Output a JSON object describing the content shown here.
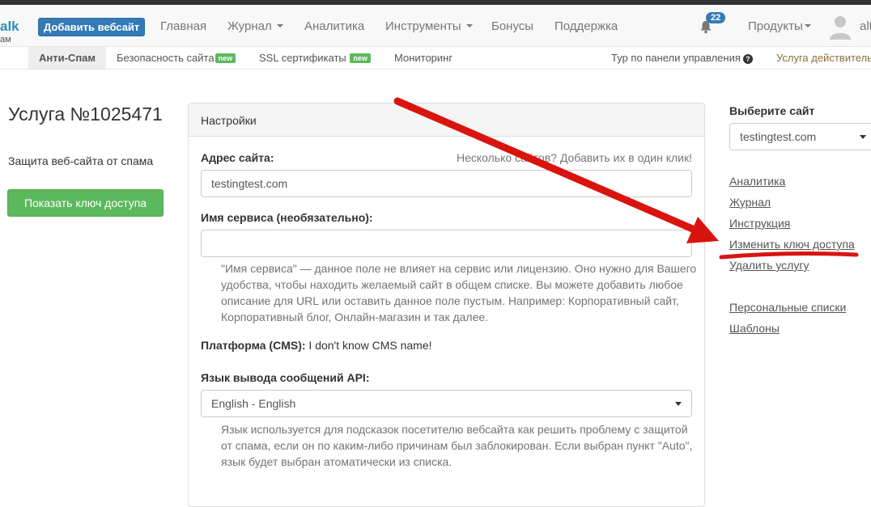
{
  "header": {
    "brand": "alk",
    "brand_sub": "ам",
    "add_site_button": "Добавить вебсайт",
    "nav": [
      "Главная",
      "Журнал",
      "Аналитика",
      "Инструменты",
      "Бонусы",
      "Поддержка"
    ],
    "notifications_count": "22",
    "products": "Продукты",
    "username": "alt"
  },
  "subnav": {
    "active": "Анти-Спам",
    "site_security": "Безопасность сайта",
    "ssl": "SSL сертификаты",
    "new_label": "new",
    "monitoring": "Мониторинг",
    "tour": "Тур по панели управления",
    "status": "Услуга действительн"
  },
  "left": {
    "title": "Услуга №1025471",
    "subtitle": "Защита веб-сайта от спама",
    "show_key_button": "Показать ключ доступа"
  },
  "settings": {
    "heading": "Настройки",
    "site_address_label": "Адрес сайта:",
    "multi_sites_link": "Несколько сайтов? Добавить их в один клик!",
    "site_address_value": "testingtest.com",
    "service_name_label": "Имя сервиса (необязательно):",
    "service_name_value": "",
    "service_name_help": "\"Имя сервиса\" — данное поле не влияет на сервис или лицензию. Оно нужно для Вашего удобства, чтобы находить желаемый сайт в общем списке. Вы можете добавить любое описание для URL или оставить данное поле пустым. Например: Корпоративный сайт, Корпоративный блог, Онлайн-магазин и так далее.",
    "platform_label": "Платформа (CMS):",
    "platform_value": "I don't know CMS name!",
    "api_lang_label": "Язык вывода сообщений API:",
    "api_lang_value": "English - English",
    "api_lang_help": "Язык используется для подсказок посетителю вебсайта как решить проблему с защитой от спама, если он по каким-либо причинам был заблокирован. Если выбран пункт \"Auto\", язык будет выбран атоматически из списка."
  },
  "sidebar": {
    "title": "Выберите сайт",
    "selected_site": "testingtest.com",
    "links": [
      "Аналитика",
      "Журнал",
      "Инструкция",
      "Изменить ключ доступа",
      "Удалить услугу"
    ],
    "links2": [
      "Персональные списки",
      "Шаблоны"
    ]
  },
  "annotation": {
    "arrow_color": "#d9140f",
    "highlighted": "Изменить ключ доступа"
  }
}
